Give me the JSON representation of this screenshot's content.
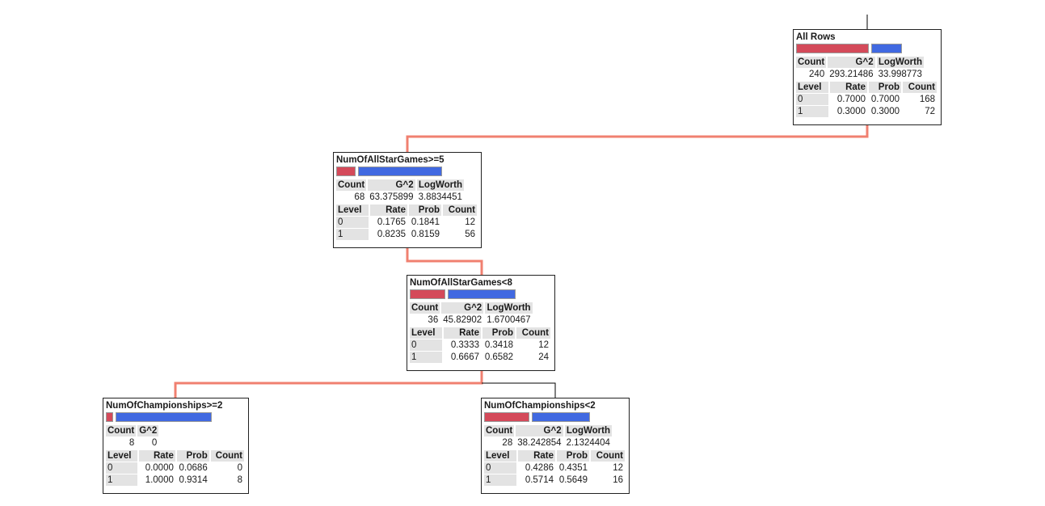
{
  "colors": {
    "split_line": "#f08070",
    "other_line": "#000000",
    "level0_bar": "#d44a5a",
    "level1_bar": "#4169e1"
  },
  "nodes": {
    "root": {
      "title": "All Rows",
      "probs": [
        0.7,
        0.3
      ],
      "stats_headers": [
        "Count",
        "G^2",
        "LogWorth"
      ],
      "stats_values": [
        "240",
        "293.21486",
        "33.998773"
      ],
      "level_headers": [
        "Level",
        "Rate",
        "Prob",
        "Count"
      ],
      "levels": [
        {
          "level": "0",
          "rate": "0.7000",
          "prob": "0.7000",
          "count": "168"
        },
        {
          "level": "1",
          "rate": "0.3000",
          "prob": "0.3000",
          "count": "72"
        }
      ]
    },
    "allstar_ge5": {
      "title": "NumOfAllStarGames>=5",
      "probs": [
        0.1841,
        0.8159
      ],
      "stats_headers": [
        "Count",
        "G^2",
        "LogWorth"
      ],
      "stats_values": [
        "68",
        "63.375899",
        "3.8834451"
      ],
      "level_headers": [
        "Level",
        "Rate",
        "Prob",
        "Count"
      ],
      "levels": [
        {
          "level": "0",
          "rate": "0.1765",
          "prob": "0.1841",
          "count": "12"
        },
        {
          "level": "1",
          "rate": "0.8235",
          "prob": "0.8159",
          "count": "56"
        }
      ]
    },
    "allstar_lt8": {
      "title": "NumOfAllStarGames<8",
      "probs": [
        0.3418,
        0.6582
      ],
      "stats_headers": [
        "Count",
        "G^2",
        "LogWorth"
      ],
      "stats_values": [
        "36",
        "45.82902",
        "1.6700467"
      ],
      "level_headers": [
        "Level",
        "Rate",
        "Prob",
        "Count"
      ],
      "levels": [
        {
          "level": "0",
          "rate": "0.3333",
          "prob": "0.3418",
          "count": "12"
        },
        {
          "level": "1",
          "rate": "0.6667",
          "prob": "0.6582",
          "count": "24"
        }
      ]
    },
    "champ_ge2": {
      "title": "NumOfChampionships>=2",
      "probs": [
        0.0686,
        0.9314
      ],
      "stats_headers": [
        "Count",
        "G^2"
      ],
      "stats_values": [
        "8",
        "0"
      ],
      "level_headers": [
        "Level",
        "Rate",
        "Prob",
        "Count"
      ],
      "levels": [
        {
          "level": "0",
          "rate": "0.0000",
          "prob": "0.0686",
          "count": "0"
        },
        {
          "level": "1",
          "rate": "1.0000",
          "prob": "0.9314",
          "count": "8"
        }
      ]
    },
    "champ_lt2": {
      "title": "NumOfChampionships<2",
      "probs": [
        0.4351,
        0.5649
      ],
      "stats_headers": [
        "Count",
        "G^2",
        "LogWorth"
      ],
      "stats_values": [
        "28",
        "38.242854",
        "2.1324404"
      ],
      "level_headers": [
        "Level",
        "Rate",
        "Prob",
        "Count"
      ],
      "levels": [
        {
          "level": "0",
          "rate": "0.4286",
          "prob": "0.4351",
          "count": "12"
        },
        {
          "level": "1",
          "rate": "0.5714",
          "prob": "0.5649",
          "count": "16"
        }
      ]
    }
  }
}
